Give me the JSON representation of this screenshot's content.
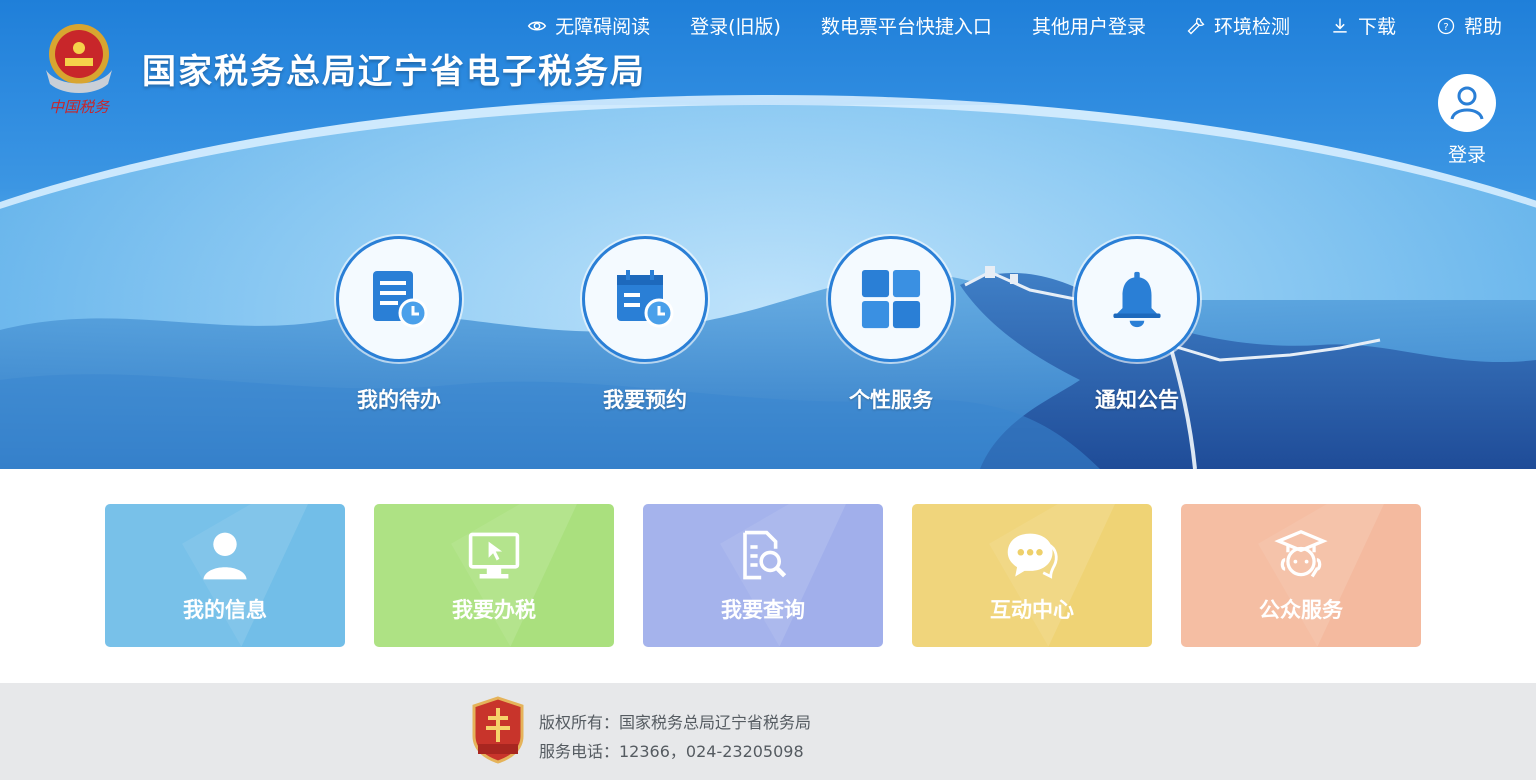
{
  "header": {
    "site_title": "国家税务总局辽宁省电子税务局",
    "nav": [
      {
        "label": "无障碍阅读",
        "icon": "eye-icon"
      },
      {
        "label": "登录(旧版)",
        "icon": ""
      },
      {
        "label": "数电票平台快捷入口",
        "icon": ""
      },
      {
        "label": "其他用户登录",
        "icon": ""
      },
      {
        "label": "环境检测",
        "icon": "wrench-icon"
      },
      {
        "label": "下载",
        "icon": "download-icon"
      },
      {
        "label": "帮助",
        "icon": "help-icon"
      }
    ],
    "login_label": "登录"
  },
  "features": [
    {
      "label": "我的待办",
      "icon": "todo-list-icon"
    },
    {
      "label": "我要预约",
      "icon": "calendar-clock-icon"
    },
    {
      "label": "个性服务",
      "icon": "grid-icon"
    },
    {
      "label": "通知公告",
      "icon": "bell-icon"
    }
  ],
  "tiles": [
    {
      "label": "我的信息",
      "icon": "user-icon",
      "color": "#66b9e6"
    },
    {
      "label": "我要办税",
      "icon": "monitor-cursor-icon",
      "color": "#a3de74"
    },
    {
      "label": "我要查询",
      "icon": "document-search-icon",
      "color": "#99a9ea"
    },
    {
      "label": "互动中心",
      "icon": "chat-bubble-icon",
      "color": "#eed06a"
    },
    {
      "label": "公众服务",
      "icon": "graduate-support-icon",
      "color": "#f4b597"
    }
  ],
  "footer": {
    "copyright": "版权所有：国家税务总局辽宁省税务局",
    "phone": "服务电话：12366，024-23205098"
  },
  "colors": {
    "header_blue": "#1f7fd9",
    "feature_blue": "#2a7fd6",
    "footer_bg": "#e7e8ea"
  }
}
